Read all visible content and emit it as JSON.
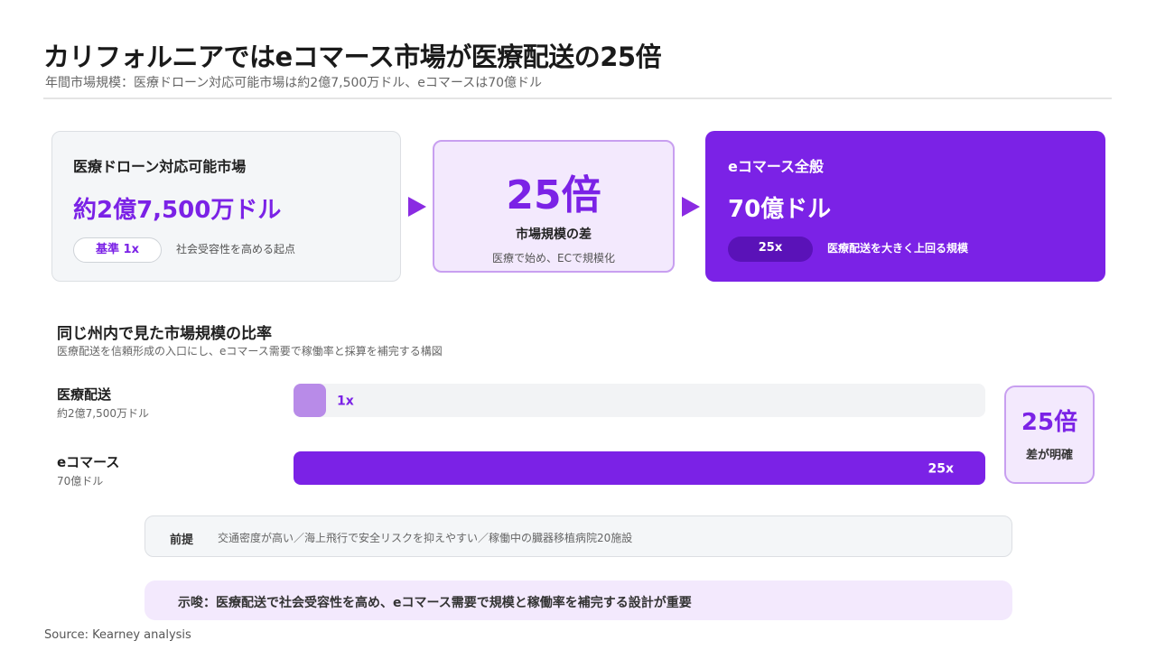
{
  "title": "カリフォルニアではeコマース市場が医療配送の25倍",
  "subtitle": "年間市場規模：医療ドローン対応可能市場は約2億7,500万ドル、eコマースは70億ドル",
  "cards": {
    "medical": {
      "label": "医療ドローン対応可能市場",
      "value": "約2億7,500万ドル",
      "pill": "基準 1x",
      "note": "社会受容性を高める起点"
    },
    "multiplier": {
      "value": "25倍",
      "label": "市場規模の差",
      "note": "医療で始め、ECで規模化"
    },
    "ecommerce": {
      "label": "eコマース全般",
      "value": "70億ドル",
      "pill": "25x",
      "note": "医療配送を大きく上回る規模"
    }
  },
  "section": {
    "title": "同じ州内で見た市場規模の比率",
    "subtitle": "医療配送を信頼形成の入口にし、eコマース需要で稼働率と採算を補完する構図"
  },
  "chart_data": {
    "type": "bar",
    "orientation": "horizontal",
    "categories": [
      "医療配送",
      "eコマース"
    ],
    "category_sublabels": [
      "約2億7,500万ドル",
      "70億ドル"
    ],
    "values": [
      1,
      25
    ],
    "value_labels": [
      "1x",
      "25x"
    ],
    "xlim": [
      0,
      25
    ],
    "grid": false,
    "colors": [
      "#b88be8",
      "#7b22e6"
    ],
    "track_color": "#f2f3f5"
  },
  "ratio_box": {
    "value": "25倍",
    "label": "差が明確"
  },
  "premise": {
    "label": "前提",
    "text": "交通密度が高い／海上飛行で安全リスクを抑えやすい／稼働中の臓器移植病院20施設"
  },
  "implication": "示唆：医療配送で社会受容性を高め、eコマース需要で規模と稼働率を補完する設計が重要",
  "source": "Source: Kearney analysis",
  "colors": {
    "accent": "#7b22e6",
    "accent_light": "#f3e9fd",
    "accent_border": "#c89ff0"
  }
}
